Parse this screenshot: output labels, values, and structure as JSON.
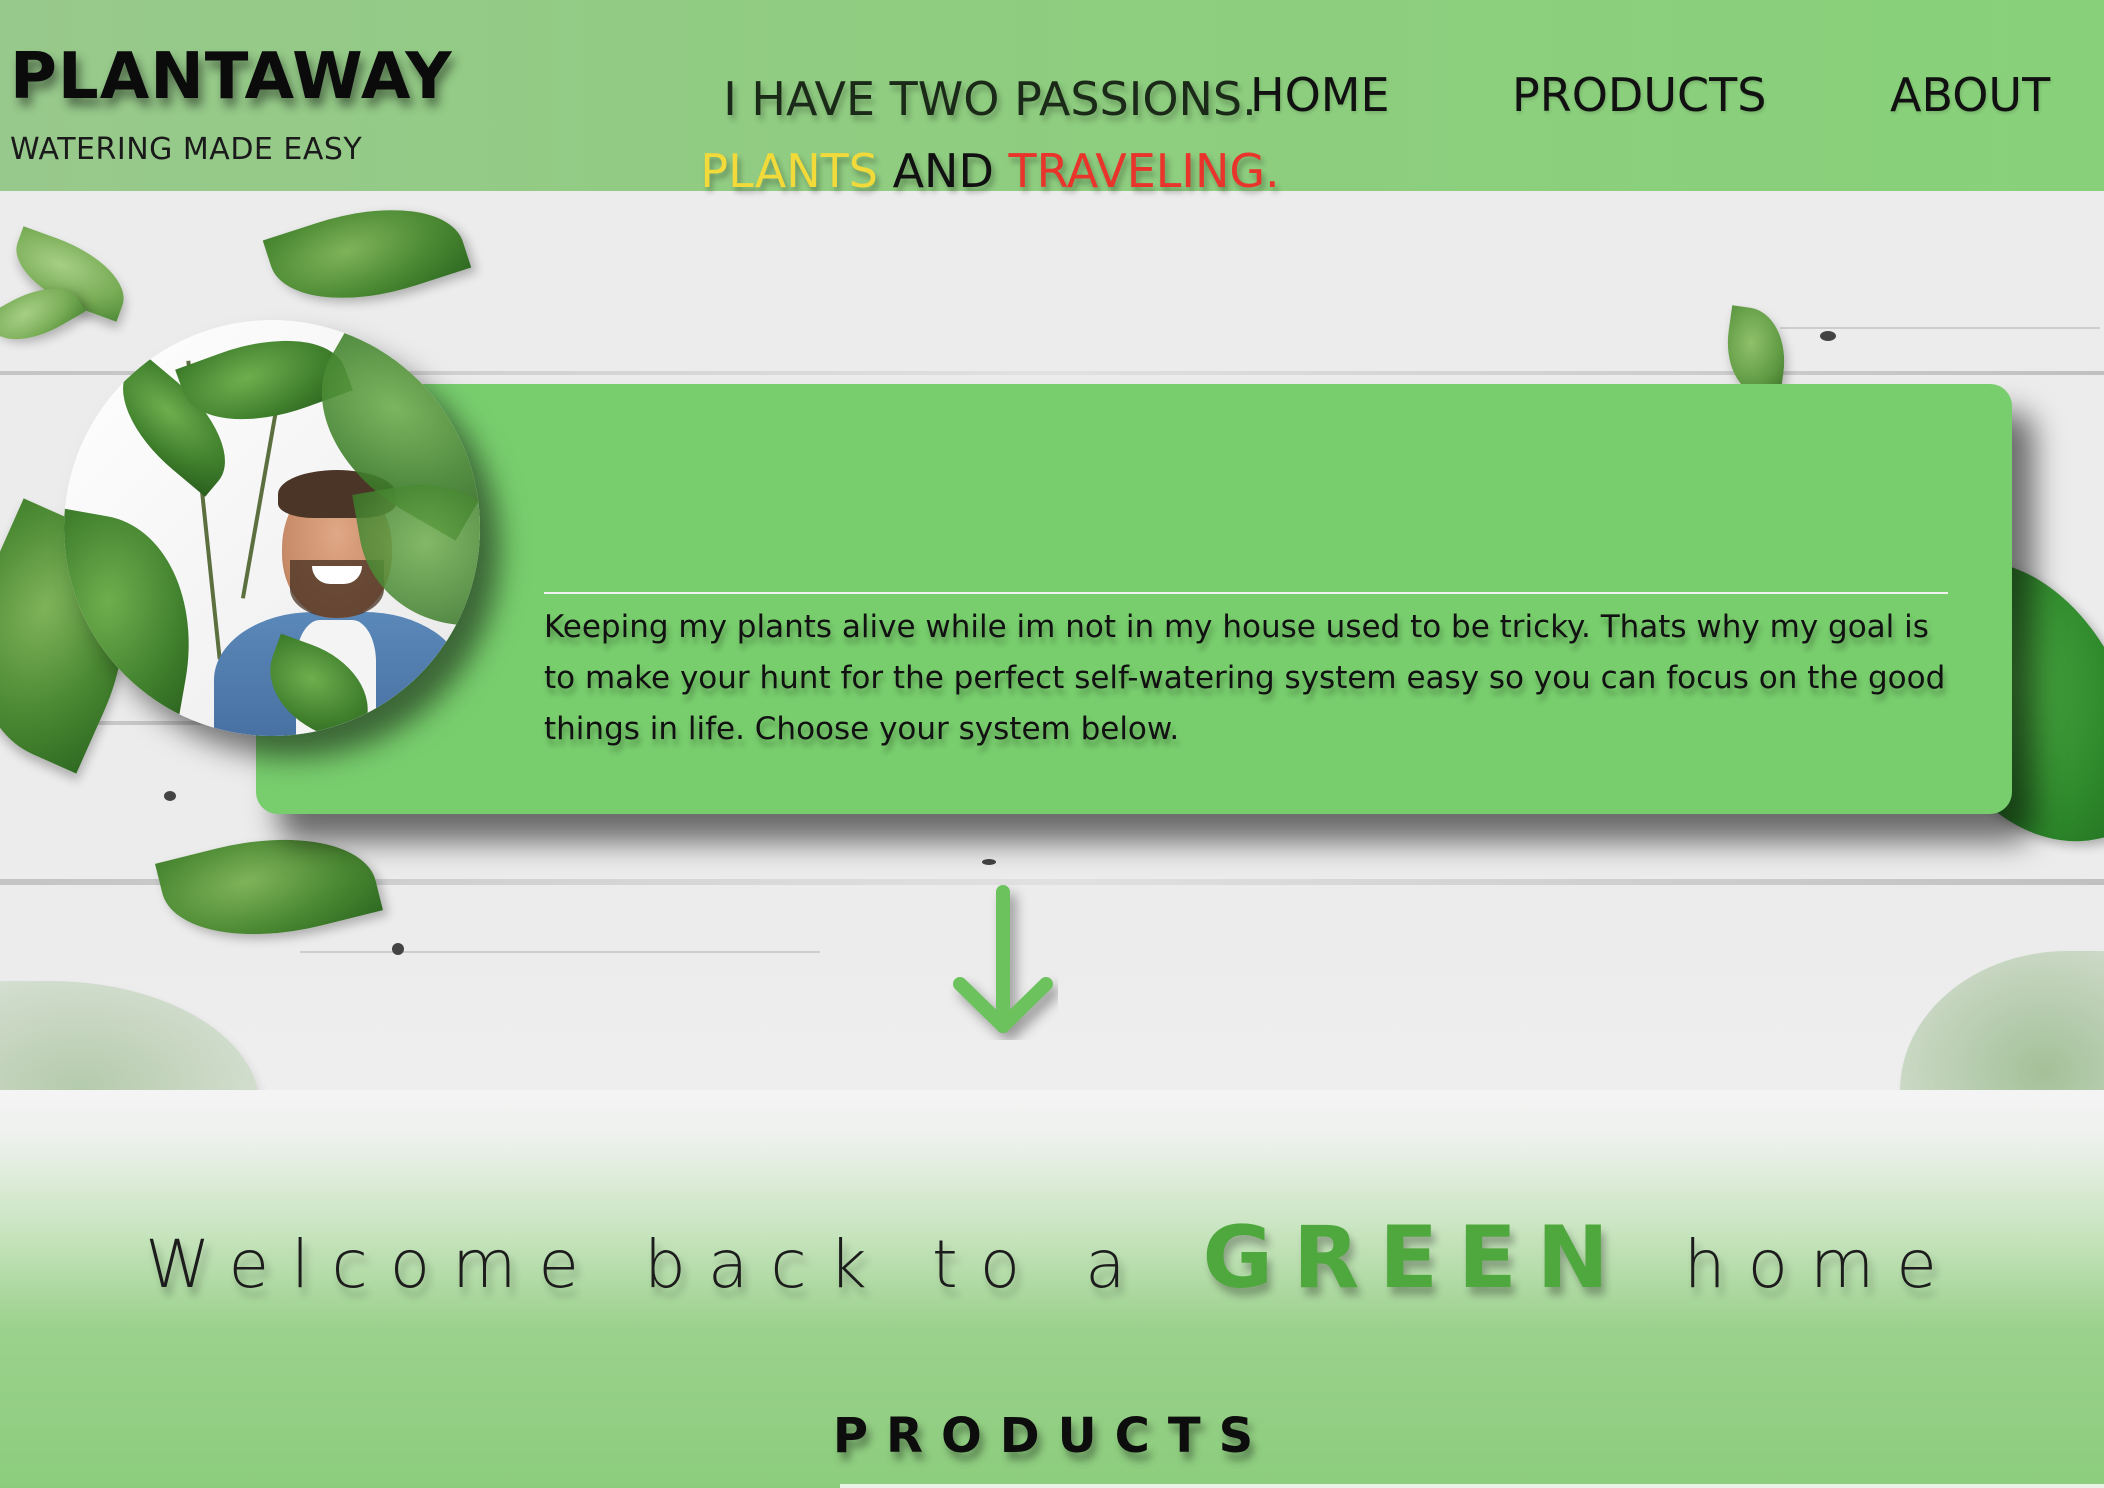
{
  "brand": {
    "title": "PLANTAWAY",
    "tagline": "WATERING MADE EASY"
  },
  "nav": {
    "items": [
      {
        "label": "HOME"
      },
      {
        "label": "PRODUCTS"
      },
      {
        "label": "ABOUT"
      }
    ]
  },
  "intro": {
    "heading": "I HAVE TWO PASSIONS.",
    "sub": {
      "plants": "PLANTS",
      "and": "AND",
      "traveling": "TRAVELING."
    },
    "body": "Keeping my plants alive while im not in my house used to be tricky. Thats why my goal is to make your hunt for the perfect self-watering system easy so you can focus on the good things in life. Choose your system below."
  },
  "welcome": {
    "before": "Welcome back to a",
    "highlight": "GREEN",
    "after": "home"
  },
  "products": {
    "heading": "PRODUCTS"
  },
  "icons": {
    "scroll_arrow": "arrow-down-icon"
  },
  "colors": {
    "header_green": "#8fcd80",
    "card_green": "#78ce6d",
    "plants_yellow": "#f1da3a",
    "traveling_red": "#e8342b",
    "green_word": "#4ea83d"
  }
}
